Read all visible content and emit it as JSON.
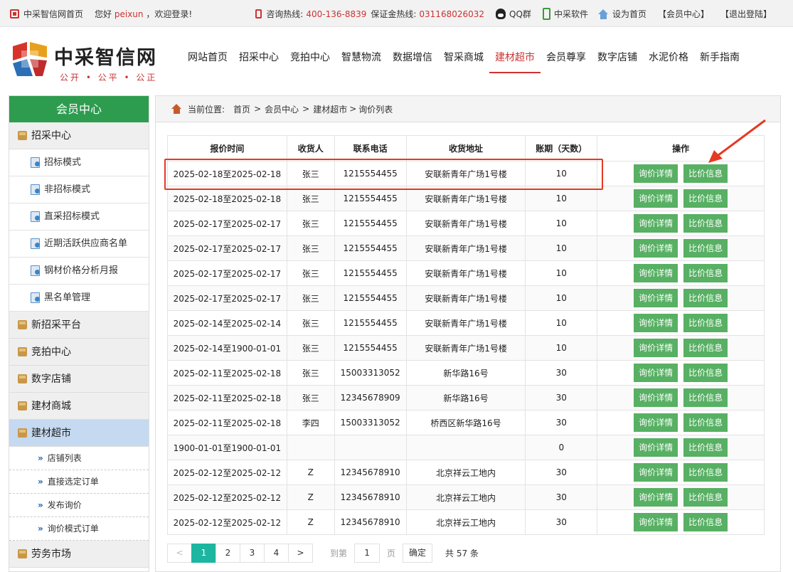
{
  "topbar": {
    "home_label": "中采智信网首页",
    "greeting_prefix": "您好",
    "username": "peixun",
    "greeting_suffix": "，欢迎登录!",
    "hotline_label": "咨询热线:",
    "hotline": "400-136-8839",
    "deposit_label": "保证金热线:",
    "deposit": "031168026032",
    "qq": "QQ群",
    "software": "中采软件",
    "homepage": "设为首页",
    "member_center": "【会员中心】",
    "logout": "【退出登陆】"
  },
  "logo": {
    "title": "中采智信网",
    "slogan": "公开 • 公平 • 公正"
  },
  "nav": [
    "网站首页",
    "招采中心",
    "竞拍中心",
    "智慧物流",
    "数据增信",
    "智采商城",
    "建材超市",
    "会员尊享",
    "数字店铺",
    "水泥价格",
    "新手指南"
  ],
  "nav_active_index": 6,
  "sidebar": {
    "title": "会员中心",
    "section1": "招采中心",
    "sub1": [
      "招标模式",
      "非招标模式",
      "直采招标模式",
      "近期活跃供应商名单",
      "钢材价格分析月报",
      "黑名单管理"
    ],
    "section2": "新招采平台",
    "section3": "竞拍中心",
    "section4": "数字店铺",
    "section5": "建材商城",
    "section6": "建材超市",
    "sub6": [
      "店铺列表",
      "直接选定订单",
      "发布询价",
      "询价模式订单"
    ],
    "section7": "劳务市场"
  },
  "breadcrumb": {
    "label": "当前位置:",
    "home": "首页",
    "member": "会员中心",
    "market": "建材超市",
    "current": "询价列表"
  },
  "table": {
    "headers": [
      "报价时间",
      "收货人",
      "联系电话",
      "收货地址",
      "账期（天数）",
      "操作"
    ],
    "detail_label": "询价详情",
    "compare_label": "比价信息",
    "rows": [
      [
        "2025-02-18至2025-02-18",
        "张三",
        "1215554455",
        "安联新青年广场1号楼",
        "10"
      ],
      [
        "2025-02-18至2025-02-18",
        "张三",
        "1215554455",
        "安联新青年广场1号楼",
        "10"
      ],
      [
        "2025-02-17至2025-02-17",
        "张三",
        "1215554455",
        "安联新青年广场1号楼",
        "10"
      ],
      [
        "2025-02-17至2025-02-17",
        "张三",
        "1215554455",
        "安联新青年广场1号楼",
        "10"
      ],
      [
        "2025-02-17至2025-02-17",
        "张三",
        "1215554455",
        "安联新青年广场1号楼",
        "10"
      ],
      [
        "2025-02-17至2025-02-17",
        "张三",
        "1215554455",
        "安联新青年广场1号楼",
        "10"
      ],
      [
        "2025-02-14至2025-02-14",
        "张三",
        "1215554455",
        "安联新青年广场1号楼",
        "10"
      ],
      [
        "2025-02-14至1900-01-01",
        "张三",
        "1215554455",
        "安联新青年广场1号楼",
        "10"
      ],
      [
        "2025-02-11至2025-02-18",
        "张三",
        "15003313052",
        "新华路16号",
        "30"
      ],
      [
        "2025-02-11至2025-02-18",
        "张三",
        "12345678909",
        "新华路16号",
        "30"
      ],
      [
        "2025-02-11至2025-02-18",
        "李四",
        "15003313052",
        "桥西区新华路16号",
        "30"
      ],
      [
        "1900-01-01至1900-01-01",
        "",
        "",
        "",
        "0"
      ],
      [
        "2025-02-12至2025-02-12",
        "Z",
        "12345678910",
        "北京祥云工地内",
        "30"
      ],
      [
        "2025-02-12至2025-02-12",
        "Z",
        "12345678910",
        "北京祥云工地内",
        "30"
      ],
      [
        "2025-02-12至2025-02-12",
        "Z",
        "12345678910",
        "北京祥云工地内",
        "30"
      ]
    ]
  },
  "pager": {
    "prev": "<",
    "pages": [
      "1",
      "2",
      "3",
      "4"
    ],
    "active": "1",
    "next": ">",
    "goto_label": "到第",
    "goto_value": "1",
    "page_unit": "页",
    "confirm": "确定",
    "total": "共 57 条"
  },
  "colors": {
    "brand_red": "#cc3333",
    "sidebar_green": "#2e9c4f",
    "button_green": "#57b063",
    "pager_active": "#1db6a0",
    "highlight": "#e53923"
  }
}
